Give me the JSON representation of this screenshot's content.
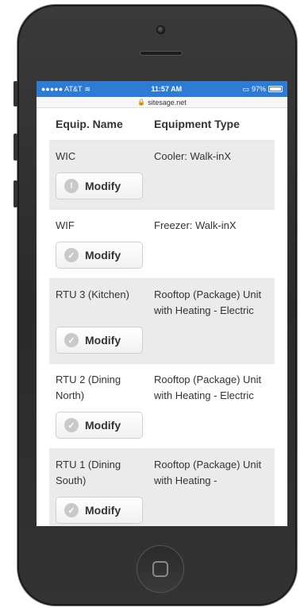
{
  "status_bar": {
    "carrier": "●●●●● AT&T",
    "time": "11:57 AM",
    "battery": "97%"
  },
  "browser": {
    "url": "sitesage.net"
  },
  "table": {
    "headers": [
      "Equip. Name",
      "Equipment Type"
    ],
    "rows": [
      {
        "name": "WIC",
        "type": "Cooler: Walk-inX",
        "button": "Modify",
        "icon": "warning-icon"
      },
      {
        "name": "WIF",
        "type": "Freezer: Walk-inX",
        "button": "Modify",
        "icon": "check-icon"
      },
      {
        "name": "RTU 3 (Kitchen)",
        "type": "Rooftop (Package) Unit with Heating - Electric",
        "button": "Modify",
        "icon": "check-icon"
      },
      {
        "name": "RTU 2 (Dining North)",
        "type": "Rooftop (Package) Unit with Heating - Electric",
        "button": "Modify",
        "icon": "check-icon"
      },
      {
        "name": "RTU 1 (Dining South)",
        "type": "Rooftop (Package) Unit with Heating -",
        "button": "Modify",
        "icon": "check-icon"
      }
    ]
  }
}
